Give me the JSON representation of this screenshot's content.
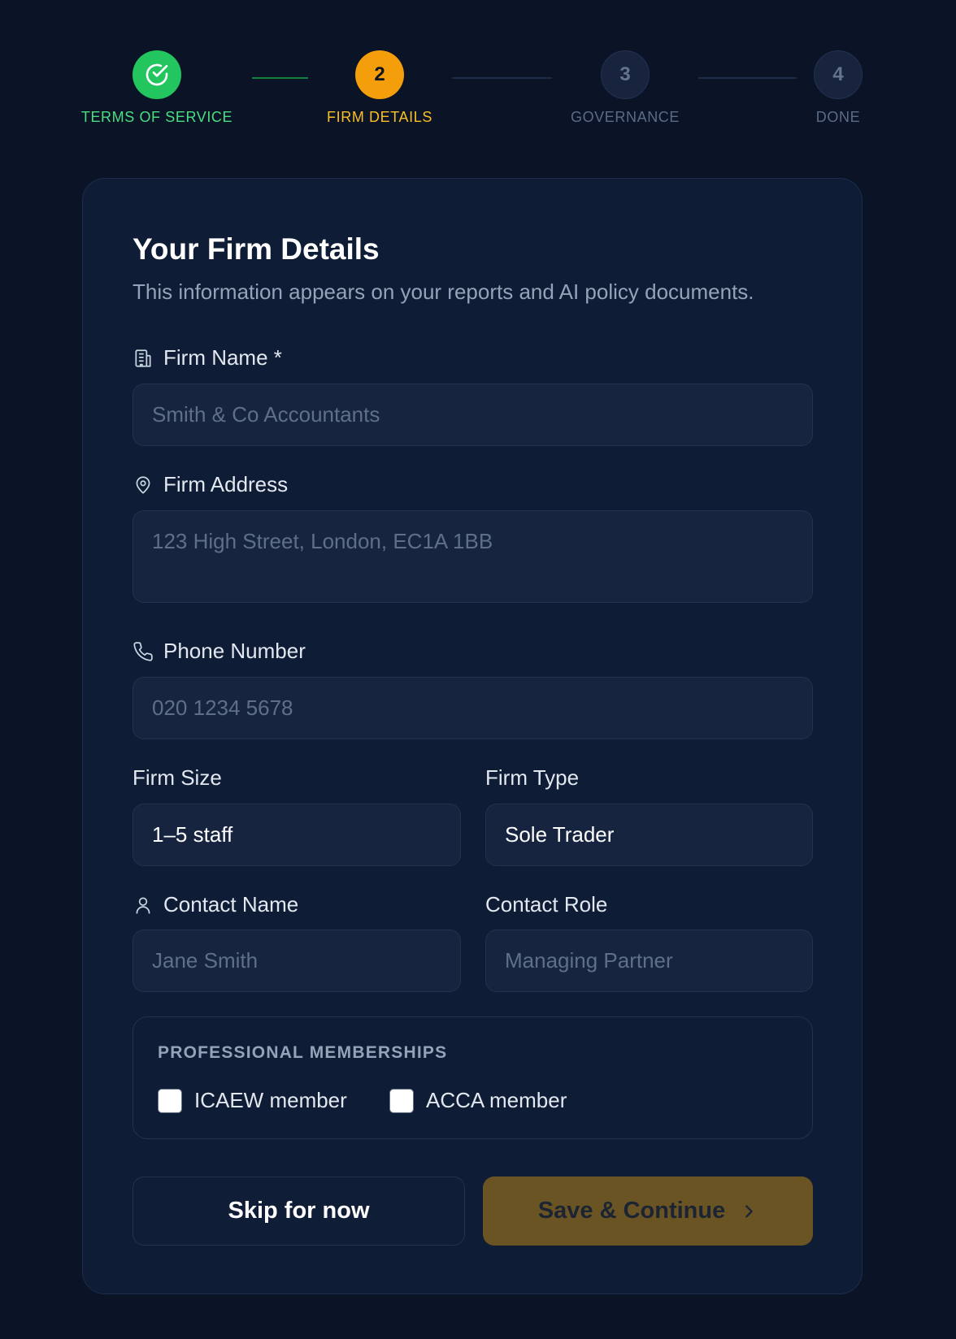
{
  "stepper": {
    "steps": [
      {
        "number": "",
        "label": "TERMS OF SERVICE",
        "state": "done"
      },
      {
        "number": "2",
        "label": "FIRM DETAILS",
        "state": "active"
      },
      {
        "number": "3",
        "label": "GOVERNANCE",
        "state": "todo"
      },
      {
        "number": "4",
        "label": "DONE",
        "state": "todo"
      }
    ]
  },
  "card": {
    "title": "Your Firm Details",
    "subtitle": "This information appears on your reports and AI policy documents."
  },
  "fields": {
    "firm_name": {
      "label": "Firm Name *",
      "placeholder": "Smith & Co Accountants",
      "icon": "building-icon"
    },
    "firm_address": {
      "label": "Firm Address",
      "placeholder": "123 High Street, London, EC1A 1BB",
      "icon": "map-pin-icon"
    },
    "phone": {
      "label": "Phone Number",
      "placeholder": "020 1234 5678",
      "icon": "phone-icon"
    },
    "firm_size": {
      "label": "Firm Size",
      "value": "1–5 staff"
    },
    "firm_type": {
      "label": "Firm Type",
      "value": "Sole Trader"
    },
    "contact_name": {
      "label": "Contact Name",
      "placeholder": "Jane Smith",
      "icon": "user-icon"
    },
    "contact_role": {
      "label": "Contact Role",
      "placeholder": "Managing Partner"
    }
  },
  "memberships": {
    "title": "PROFESSIONAL MEMBERSHIPS",
    "options": [
      {
        "label": "ICAEW member",
        "checked": false
      },
      {
        "label": "ACCA member",
        "checked": false
      }
    ]
  },
  "actions": {
    "skip_label": "Skip for now",
    "save_label": "Save & Continue"
  },
  "colors": {
    "background": "#0a1426",
    "card": "#0f1c35",
    "step_done": "#22c55e",
    "step_active": "#f59e0b",
    "save_button": "#6b5423"
  }
}
